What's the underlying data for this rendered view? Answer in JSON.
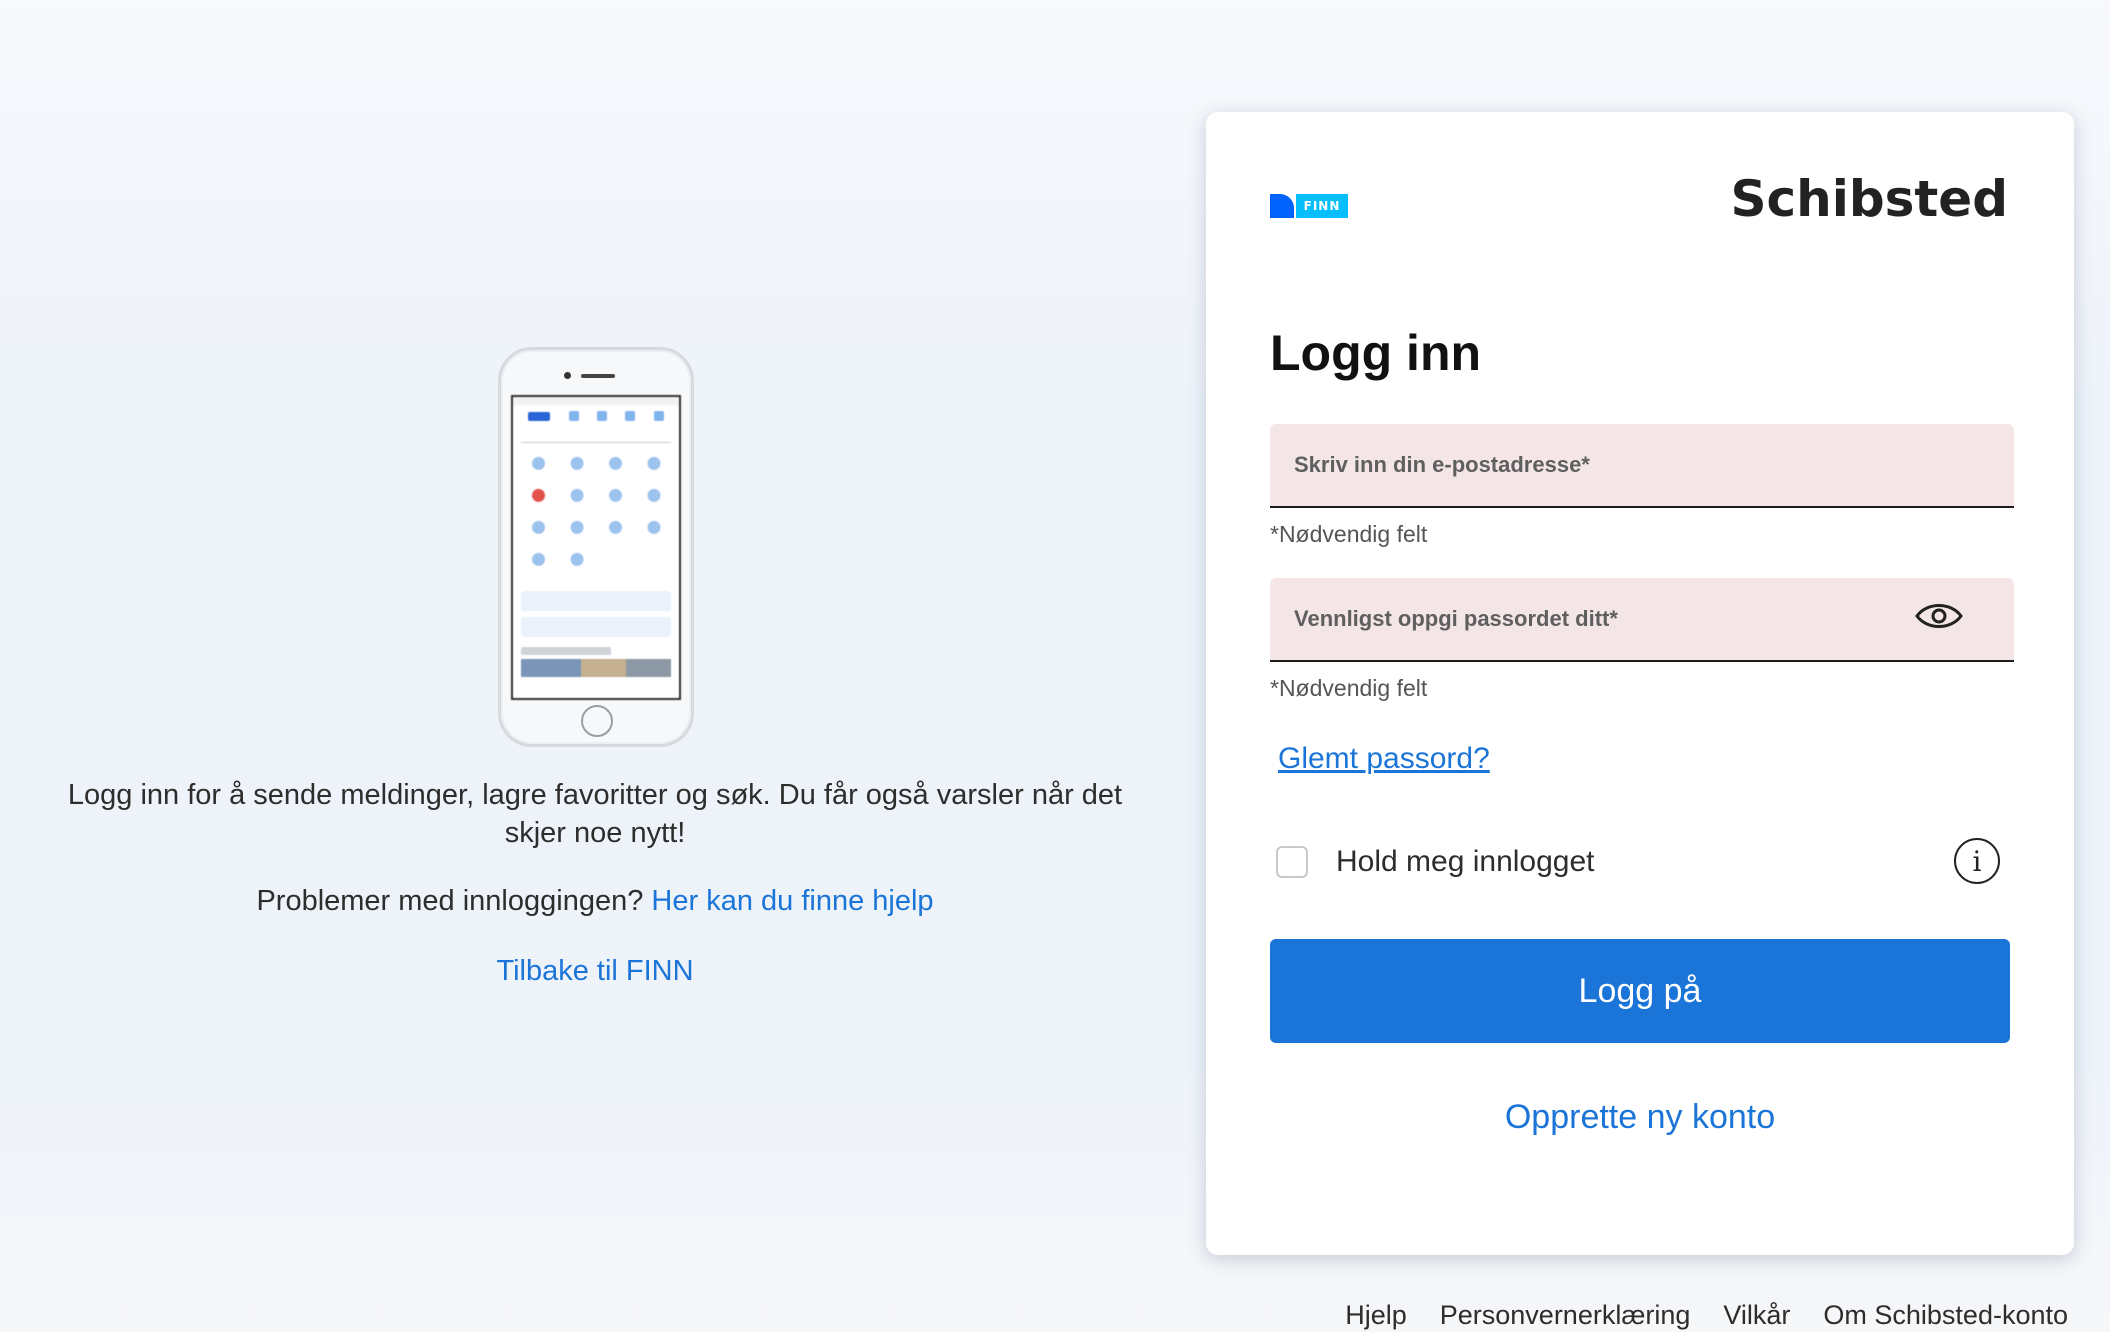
{
  "left": {
    "intro": "Logg inn for å sende meldinger, lagre favoritter og søk. Du får også varsler når det skjer noe nytt!",
    "problems_text": "Problemer med innloggingen? ",
    "help_link": "Her kan du finne hjelp",
    "back_link": "Tilbake til FINN"
  },
  "card": {
    "finn_logo_text": "FINN",
    "schibsted_logo": "Schibsted",
    "title": "Logg inn",
    "email": {
      "placeholder": "Skriv inn din e-postadresse*",
      "value": "",
      "helper": "*Nødvendig felt"
    },
    "password": {
      "placeholder": "Vennligst oppgi passordet ditt*",
      "value": "",
      "helper": "*Nødvendig felt"
    },
    "forgot_link": "Glemt passord?",
    "remember_label": "Hold meg innlogget",
    "remember_checked": false,
    "info_icon": "i",
    "login_button": "Logg på",
    "create_account_link": "Opprette ny konto"
  },
  "footer": {
    "links": [
      "Hjelp",
      "Personvernerklæring",
      "Vilkår",
      "Om Schibsted-konto"
    ]
  },
  "icons": {
    "eye": "eye-icon",
    "info": "info-icon"
  },
  "colors": {
    "accent": "#1b74d7",
    "field_bg": "#f4e5e6",
    "finn_blue": "#0063fb",
    "finn_cyan": "#06befb"
  }
}
